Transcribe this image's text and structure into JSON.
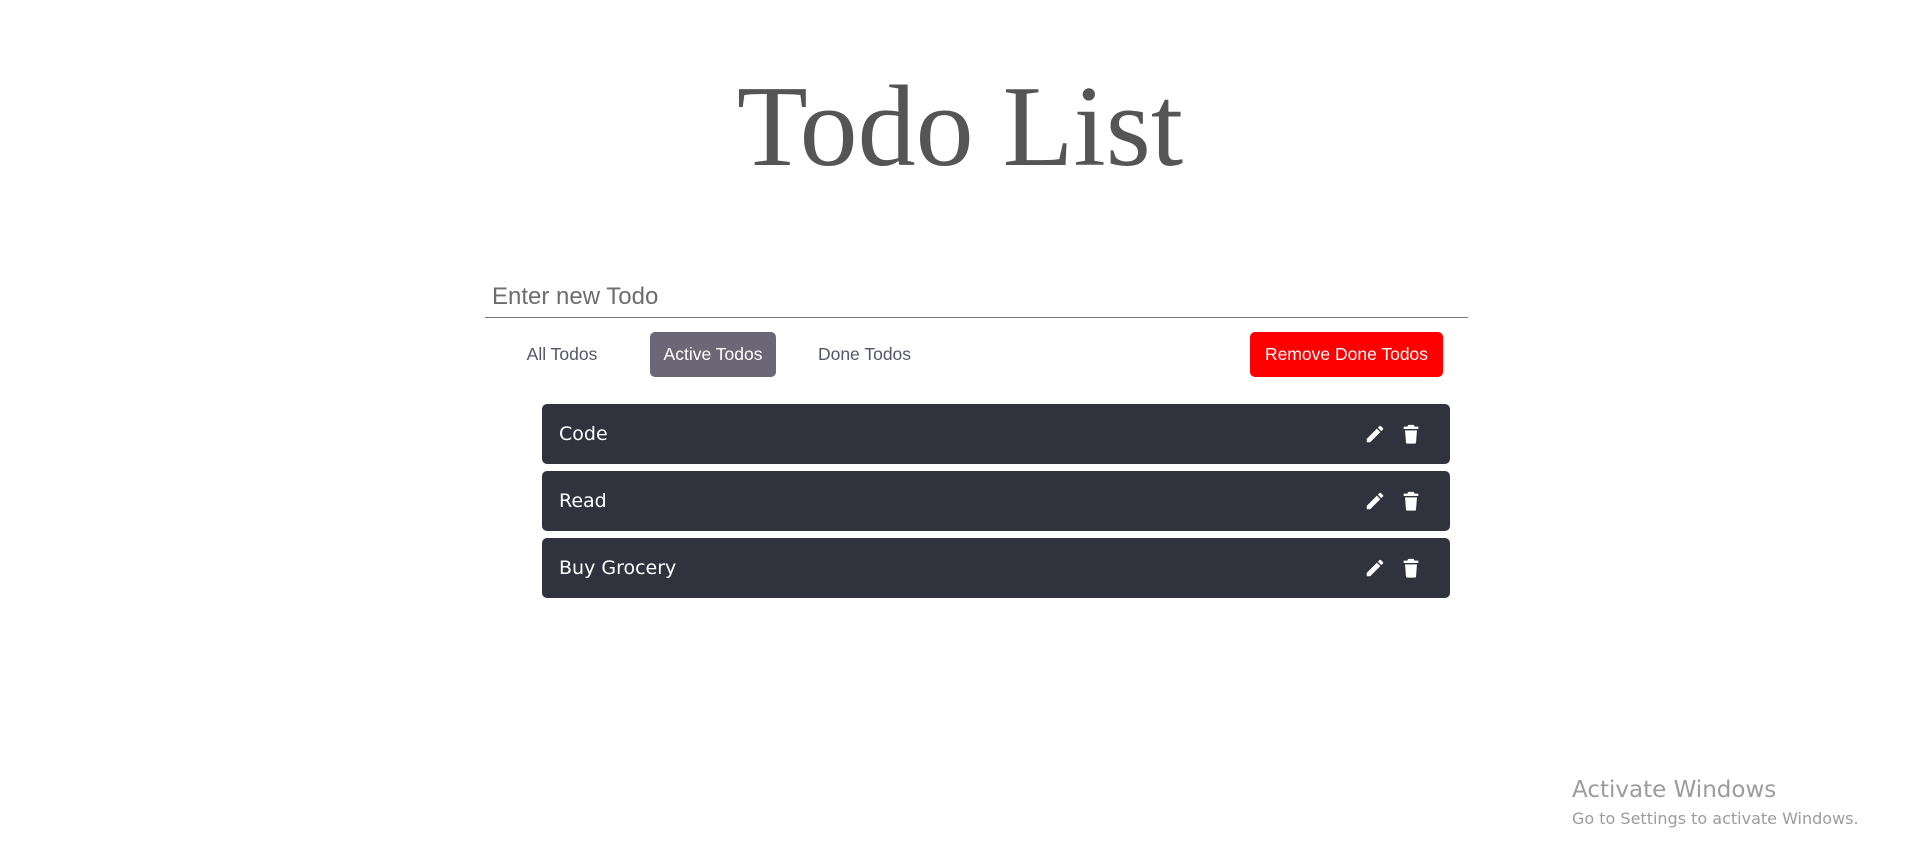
{
  "header": {
    "title": "Todo List"
  },
  "input": {
    "placeholder": "Enter new Todo",
    "value": ""
  },
  "filters": {
    "all_label": "All Todos",
    "active_label": "Active Todos",
    "done_label": "Done Todos",
    "selected": "Active Todos",
    "remove_done_label": "Remove Done Todos"
  },
  "todos": [
    {
      "text": "Code",
      "icons": [
        "pencil-icon",
        "trash-icon"
      ]
    },
    {
      "text": "Read",
      "icons": [
        "pencil-icon",
        "trash-icon"
      ]
    },
    {
      "text": "Buy Grocery",
      "icons": [
        "pencil-icon",
        "trash-icon"
      ]
    }
  ],
  "watermark": {
    "title": "Activate Windows",
    "subtitle": "Go to Settings to activate Windows."
  },
  "colors": {
    "title_text": "#555555",
    "active_filter_bg": "#6b6776",
    "remove_button_bg": "#ff0000",
    "todo_item_bg": "#30333e",
    "todo_text": "#ffffff"
  }
}
